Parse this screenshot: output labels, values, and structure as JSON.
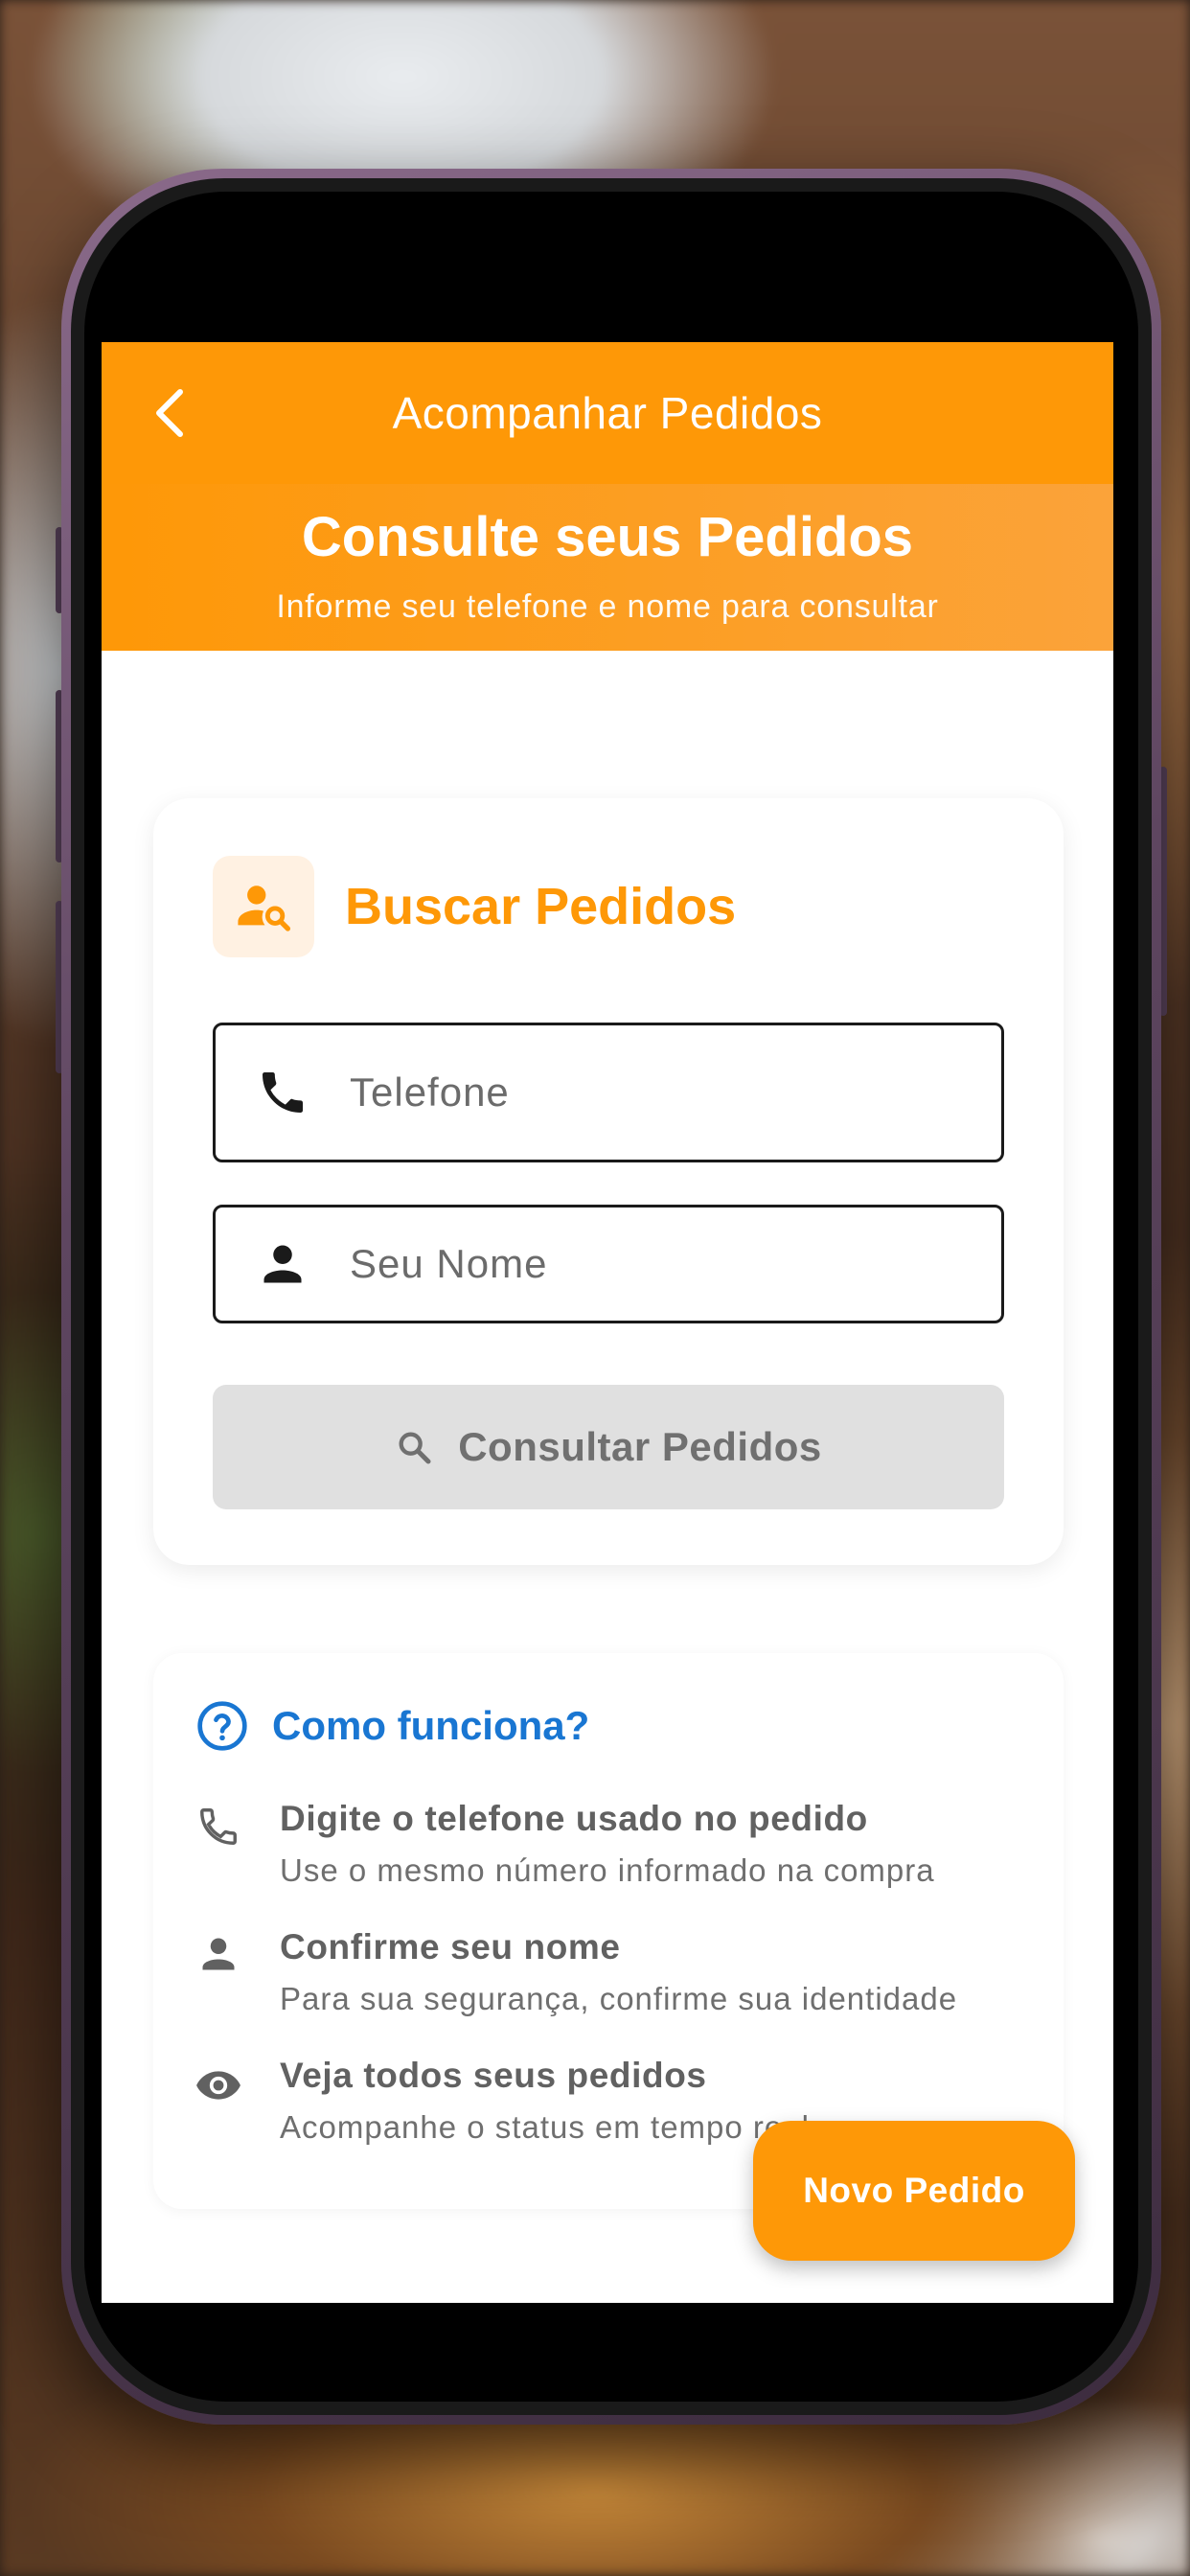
{
  "appbar": {
    "title": "Acompanhar Pedidos"
  },
  "hero": {
    "title": "Consulte seus Pedidos",
    "subtitle": "Informe seu telefone e nome para consultar"
  },
  "search_card": {
    "title": "Buscar Pedidos",
    "icon": "person-search-icon",
    "phone_placeholder": "Telefone",
    "phone_value": "",
    "name_placeholder": "Seu Nome",
    "name_value": "",
    "submit_label": "Consultar Pedidos"
  },
  "how_it_works": {
    "title": "Como funciona?",
    "steps": [
      {
        "icon": "phone-icon",
        "title": "Digite o telefone usado no pedido",
        "desc": "Use o mesmo número informado na compra"
      },
      {
        "icon": "person-icon",
        "title": "Confirme seu nome",
        "desc": "Para sua segurança, confirme sua identidade"
      },
      {
        "icon": "eye-icon",
        "title": "Veja todos seus pedidos",
        "desc": "Acompanhe o status em tempo real"
      }
    ]
  },
  "fab": {
    "label": "Novo Pedido"
  },
  "colors": {
    "primary": "#fe9807",
    "info_blue": "#1976d2",
    "disabled_button": "#e0e0e0"
  }
}
